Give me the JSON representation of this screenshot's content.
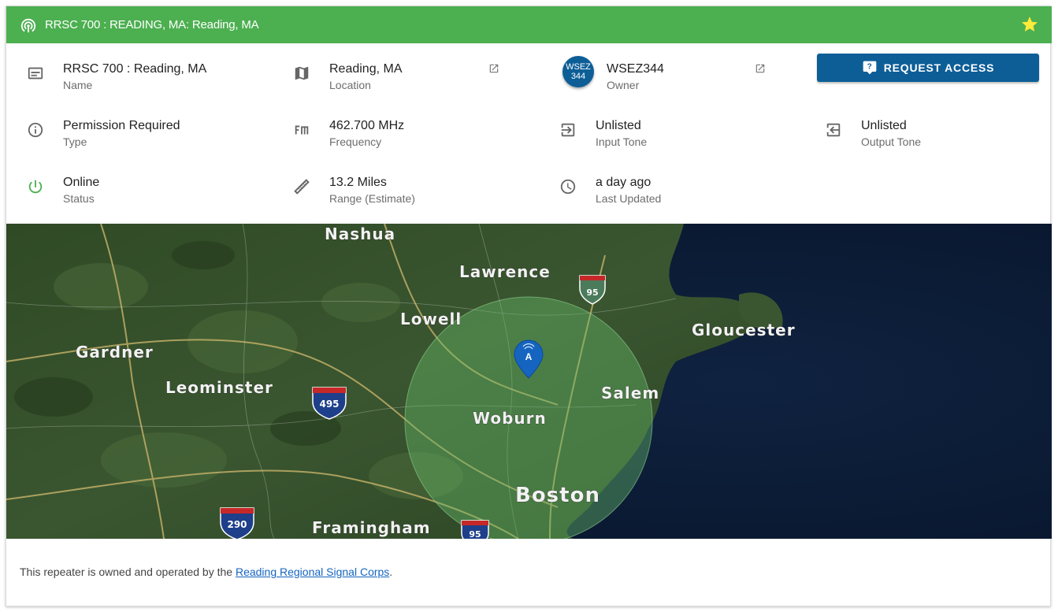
{
  "header": {
    "title": "RRSC 700 : READING, MA: Reading, MA",
    "color": "#4caf50",
    "star_color": "#ffeb3b"
  },
  "details": {
    "name": {
      "value": "RRSC 700 : Reading, MA",
      "label": "Name",
      "icon": "card-text-icon"
    },
    "location": {
      "value": "Reading, MA",
      "label": "Location",
      "icon": "map-icon"
    },
    "owner": {
      "value": "WSEZ344",
      "label": "Owner",
      "avatar_line1": "WSEZ",
      "avatar_line2": "344"
    },
    "type": {
      "value": "Permission Required",
      "label": "Type",
      "icon": "info-icon"
    },
    "frequency": {
      "value": "462.700 MHz",
      "label": "Frequency",
      "icon": "fm-icon"
    },
    "input_tone": {
      "value": "Unlisted",
      "label": "Input Tone",
      "icon": "input-icon"
    },
    "output_tone": {
      "value": "Unlisted",
      "label": "Output Tone",
      "icon": "output-icon"
    },
    "status": {
      "value": "Online",
      "label": "Status",
      "icon": "power-icon",
      "color": "#4caf50"
    },
    "range": {
      "value": "13.2 Miles",
      "label": "Range (Estimate)",
      "icon": "ruler-icon"
    },
    "last_updated": {
      "value": "a day ago",
      "label": "Last Updated",
      "icon": "clock-icon"
    }
  },
  "request_button": {
    "label": "REQUEST ACCESS",
    "color": "#0d5e97"
  },
  "map": {
    "labels": [
      "Nashua",
      "Lawrence",
      "Lowell",
      "Gloucester",
      "Gardner",
      "Leominster",
      "Salem",
      "Woburn",
      "Boston",
      "Framingham"
    ],
    "shields": [
      "95",
      "495",
      "290",
      "95"
    ],
    "marker_letter": "A",
    "coverage_color": "#66bb6a"
  },
  "footer": {
    "text_before": "This repeater is owned and operated by the ",
    "link": "Reading Regional Signal Corps",
    "text_after": "."
  }
}
